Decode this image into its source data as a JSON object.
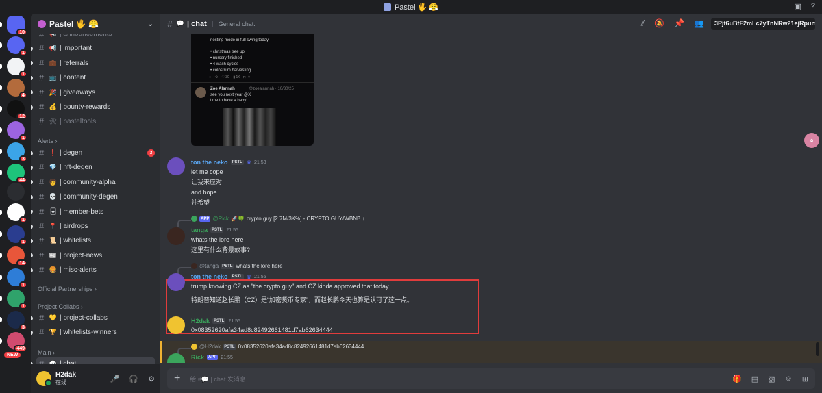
{
  "window": {
    "title": "Pastel 🖐 😤"
  },
  "rail": {
    "servers": [
      {
        "color": "#5865f2",
        "badge": "10"
      },
      {
        "color": "#5865f2",
        "badge": "1"
      },
      {
        "color": "#f2f3f5",
        "badge": "1"
      },
      {
        "color": "#b36b3c",
        "badge": "4"
      },
      {
        "color": "#111111",
        "badge": "12"
      },
      {
        "color": "#9c64e0",
        "badge": "1"
      },
      {
        "color": "#3ba4e8",
        "badge": "3"
      },
      {
        "color": "#1ec47b",
        "badge": "44"
      },
      {
        "color": "#2b2d31",
        "badge": ""
      },
      {
        "color": "#ffffff",
        "badge": "1"
      },
      {
        "color": "#2a3d8f",
        "badge": "1"
      },
      {
        "color": "#e8563a",
        "badge": "14"
      },
      {
        "color": "#2e7dd7",
        "badge": "1"
      },
      {
        "color": "#2fa36b",
        "badge": "1"
      },
      {
        "color": "#1b2a4a",
        "badge": "3"
      },
      {
        "color": "#d14b6f",
        "badge": "449"
      }
    ],
    "new_badge": "NEW"
  },
  "sidebar": {
    "guild_name": "Pastel 🖐 😤",
    "channels_top": [
      {
        "emoji": "📢",
        "name": "| announcements",
        "muted": true
      },
      {
        "emoji": "📢",
        "name": "| important"
      },
      {
        "emoji": "💼",
        "name": "| referrals"
      },
      {
        "emoji": "📺",
        "name": "| content"
      },
      {
        "emoji": "🎉",
        "name": "| giveaways"
      },
      {
        "emoji": "💰",
        "name": "| bounty-rewards"
      },
      {
        "emoji": "🛠",
        "name": "| pasteltools",
        "muted": true
      }
    ],
    "cat_alerts": "Alerts",
    "channels_alerts": [
      {
        "emoji": "❗",
        "name": "| degen",
        "badge": "3"
      },
      {
        "emoji": "💎",
        "name": "| nft-degen"
      },
      {
        "emoji": "🧑",
        "name": "| community-alpha"
      },
      {
        "emoji": "💀",
        "name": "| community-degen"
      },
      {
        "emoji": "🃏",
        "name": "| member-bets"
      },
      {
        "emoji": "📍",
        "name": "| airdrops"
      },
      {
        "emoji": "📜",
        "name": "| whitelists"
      },
      {
        "emoji": "📰",
        "name": "| project-news"
      },
      {
        "emoji": "🍔",
        "name": "| misc-alerts"
      }
    ],
    "cat_official": "Official Partnerships",
    "cat_collabs": "Project Collabs",
    "channels_collabs": [
      {
        "emoji": "💛",
        "name": "| project-collabs"
      },
      {
        "emoji": "🏆",
        "name": "| whitelists-winners"
      }
    ],
    "cat_main": "Main",
    "active_channel": {
      "emoji": "💬",
      "name": "| chat"
    }
  },
  "user": {
    "name": "H2dak",
    "status": "在线"
  },
  "topbar": {
    "channel": "| chat",
    "topic": "General chat.",
    "search_value": "3Pjt6uBtF2mLc7yTnNRw21ejRpump"
  },
  "embed": {
    "line1": "nesting mode in full swing today",
    "bullets": [
      "• christmas tree up",
      "• nursery finished",
      "• 4 wash cycles",
      "• colostrum harvesting"
    ],
    "author": "Zoe Alannah",
    "handle": "@zoealannah · 10/30/25",
    "text1": "see you next year @X",
    "text2": "time to have a baby!"
  },
  "messages": {
    "m1": {
      "name": "ton the neko",
      "tag": "PSTL",
      "time": "21:53",
      "lines": [
        "let me cope",
        "让我来应对",
        "and hope",
        "并希望"
      ]
    },
    "m2": {
      "reply_name": "@Rick",
      "reply_text": "crypto guy [2.7M/3K%] - CRYPTO GUY/WBNB ↑",
      "reply_app": "APP",
      "name": "tanga",
      "tag": "PSTL",
      "time": "21:55",
      "lines": [
        "whats the lore here",
        "这里有什么背景故事?"
      ]
    },
    "m3": {
      "reply_name": "@tanga",
      "reply_tag": "PSTL",
      "reply_text": "whats the lore here",
      "name": "ton the neko",
      "tag": "PSTL",
      "time": "21:55",
      "lines": [
        "trump knowing CZ as \"the crypto guy\" and CZ kinda approved that today",
        "特朗普知道赵长鹏（CZ）是“加密货币专家”，而赵长鹏今天也算是认可了这一点。"
      ]
    },
    "m4": {
      "name": "H2dak",
      "tag": "PSTL",
      "time": "21:55",
      "lines": [
        "0x08352620afa34ad8c82492661481d7ab62634444"
      ]
    },
    "m5": {
      "reply_name": "@H2dak",
      "reply_tag": "PSTL",
      "reply_text": "0x08352620afa34ad8c82492661481d7ab62634444",
      "name": "Rick",
      "app": "APP",
      "time": "21:55"
    }
  },
  "composer": {
    "placeholder": "给 #💬 | chat 发消息"
  },
  "colors": {
    "accent": "#5865f2",
    "highlight": "#e03c3c",
    "mention": "#f0b232"
  }
}
